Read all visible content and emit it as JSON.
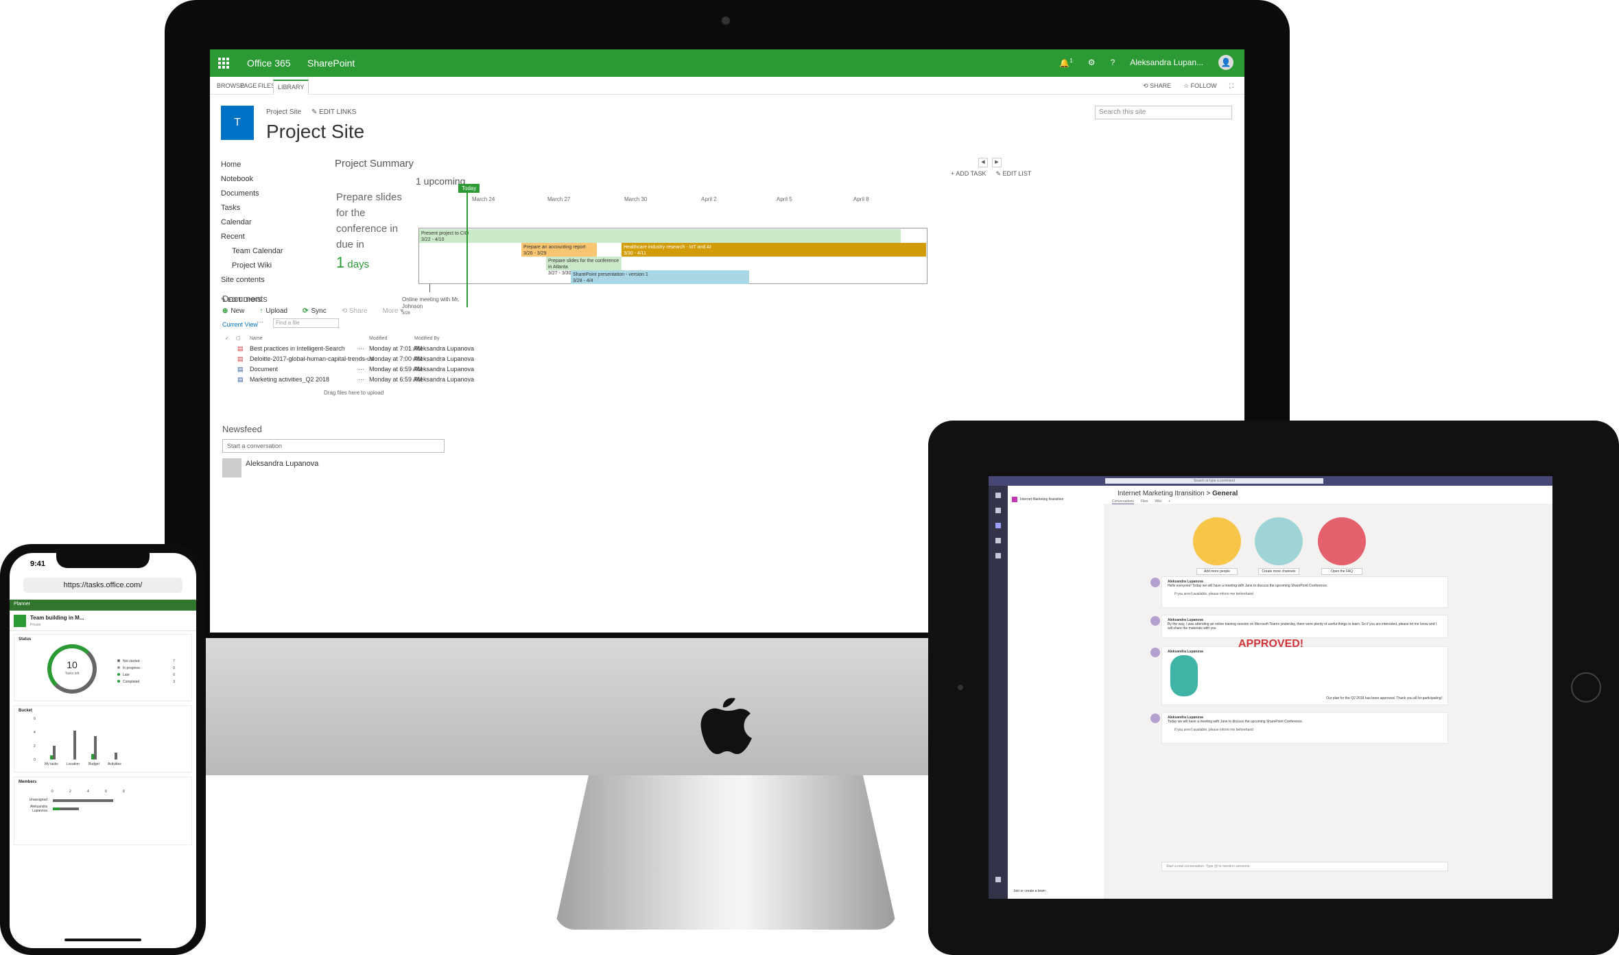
{
  "sharepoint": {
    "topbar": {
      "brand": "Office 365",
      "app": "SharePoint",
      "notif_count": "1",
      "user": "Aleksandra Lupan..."
    },
    "ribbon": {
      "tabs": [
        "BROWSE",
        "PAGE",
        "FILES",
        "LIBRARY"
      ],
      "share": "SHARE",
      "follow": "FOLLOW"
    },
    "site": {
      "logo_letter": "T",
      "breadcrumb": "Project Site",
      "edit_links": "EDIT LINKS",
      "title": "Project Site"
    },
    "search_placeholder": "Search this site",
    "nav": {
      "items": [
        "Home",
        "Notebook",
        "Documents",
        "Tasks",
        "Calendar",
        "Recent"
      ],
      "recent_items": [
        "Team Calendar",
        "Project Wiki"
      ],
      "site_contents": "Site contents",
      "edit_links": "EDIT LINKS"
    },
    "summary": {
      "heading": "Project Summary",
      "next_task": "Prepare slides for the conference in",
      "due_prefix": "due in",
      "due_number": "1",
      "due_unit": "days",
      "upcoming": "1 upcoming",
      "add_task": "ADD TASK",
      "edit_list": "EDIT LIST",
      "today": "Today",
      "axis": [
        "March 24",
        "March 27",
        "March 30",
        "April 2",
        "April 5",
        "April 8"
      ],
      "tasks": [
        {
          "name": "Present project to CIO",
          "dates": "3/22 - 4/10",
          "color": "#cbe8c8"
        },
        {
          "name": "Prepare an accounting report",
          "dates": "3/26 - 3/29",
          "color": "#f8c570"
        },
        {
          "name": "Healthcare industry research - IoT and AI",
          "dates": "3/30 - 4/11",
          "color": "#d29b08"
        },
        {
          "name": "Prepare slides for the conference in Atlanta",
          "dates": "3/27 - 3/30",
          "color": "#cbe8c8"
        },
        {
          "name": "SharePoint presentation - version 1",
          "dates": "3/28 - 4/4",
          "color": "#a9d7e6"
        }
      ],
      "milestone": {
        "name": "Online meeting with Mr. Johnson",
        "date": "3/28"
      }
    },
    "documents": {
      "heading": "Documents",
      "toolbar": {
        "new": "New",
        "upload": "Upload",
        "sync": "Sync",
        "share": "Share",
        "more": "More"
      },
      "current_view": "Current View",
      "find_placeholder": "Find a file",
      "columns": [
        "Name",
        "Modified",
        "Modified By"
      ],
      "rows": [
        {
          "name": "Best practices in Intelligent-Search",
          "modified": "Monday at 7:01 AM",
          "by": "Aleksandra Lupanova"
        },
        {
          "name": "Deloitte-2017-global-human-capital-trends-us",
          "modified": "Monday at 7:00 AM",
          "by": "Aleksandra Lupanova"
        },
        {
          "name": "Document",
          "modified": "Monday at 6:59 AM",
          "by": "Aleksandra Lupanova"
        },
        {
          "name": "Marketing activities_Q2 2018",
          "modified": "Monday at 6:59 AM",
          "by": "Aleksandra Lupanova"
        }
      ],
      "drag_hint": "Drag files here to upload"
    },
    "newsfeed": {
      "heading": "Newsfeed",
      "placeholder": "Start a conversation",
      "user": "Aleksandra Lupanova"
    }
  },
  "teams": {
    "search": "Search or type a command",
    "team_name": "Internet Marketing Itransition",
    "channel_path": "Internet Marketing Itransition",
    "channel": "General",
    "tabs": [
      "Conversations",
      "Files",
      "Wiki"
    ],
    "illustrations": [
      "Add more people",
      "Create more channels",
      "Open the FAQ"
    ],
    "messages": [
      {
        "author": "Aleksandra Lupanova",
        "text": "Hello everyone! Today we will have a meeting with Jane to discuss the upcoming SharePoint Conference.",
        "reply": "If you aren't available, please inform me beforehand"
      },
      {
        "author": "Aleksandra Lupanova",
        "text": "By the way, I was attending an online training session on Microsoft Teams yesterday, there were plenty of useful things to learn. So if you are interested, please let me know and I will share the materials with you"
      },
      {
        "author": "Aleksandra Lupanova",
        "text": "Our plan for the Q2 2018 has been approved. Thank you all for participating!",
        "sticker": "APPROVED!"
      },
      {
        "author": "Aleksandra Lupanova",
        "text": "Today we will have a meeting with Jane to discuss the upcoming SharePoint Conference.",
        "reply": "If you aren't available, please inform me beforehand"
      }
    ],
    "new_conversation": "Start a new conversation. Type @ to mention someone.",
    "join_team": "Join or create a team"
  },
  "planner": {
    "time": "9:41",
    "url": "https://tasks.office.com/",
    "app": "Planner",
    "plan_name": "Team building in M...",
    "plan_privacy": "Private",
    "status": {
      "title": "Status",
      "tasks_left": "10",
      "tasks_left_label": "Tasks left",
      "legend": [
        {
          "label": "Not started",
          "value": "7",
          "color": "#666666"
        },
        {
          "label": "In progress",
          "value": "0",
          "color": "#999999"
        },
        {
          "label": "Late",
          "value": "0",
          "color": "#2b9a35"
        },
        {
          "label": "Completed",
          "value": "3",
          "color": "#2b9a35"
        }
      ]
    },
    "bucket": {
      "title": "Bucket",
      "yticks": [
        "6",
        "4",
        "2",
        "0"
      ],
      "categories": [
        "My tasks",
        "Location",
        "Budget",
        "Activities"
      ]
    },
    "members": {
      "title": "Members",
      "xticks": [
        "0",
        "2",
        "4",
        "6",
        "8"
      ],
      "people": [
        "Unassigned",
        "Aleksandra Lupanova"
      ]
    }
  }
}
